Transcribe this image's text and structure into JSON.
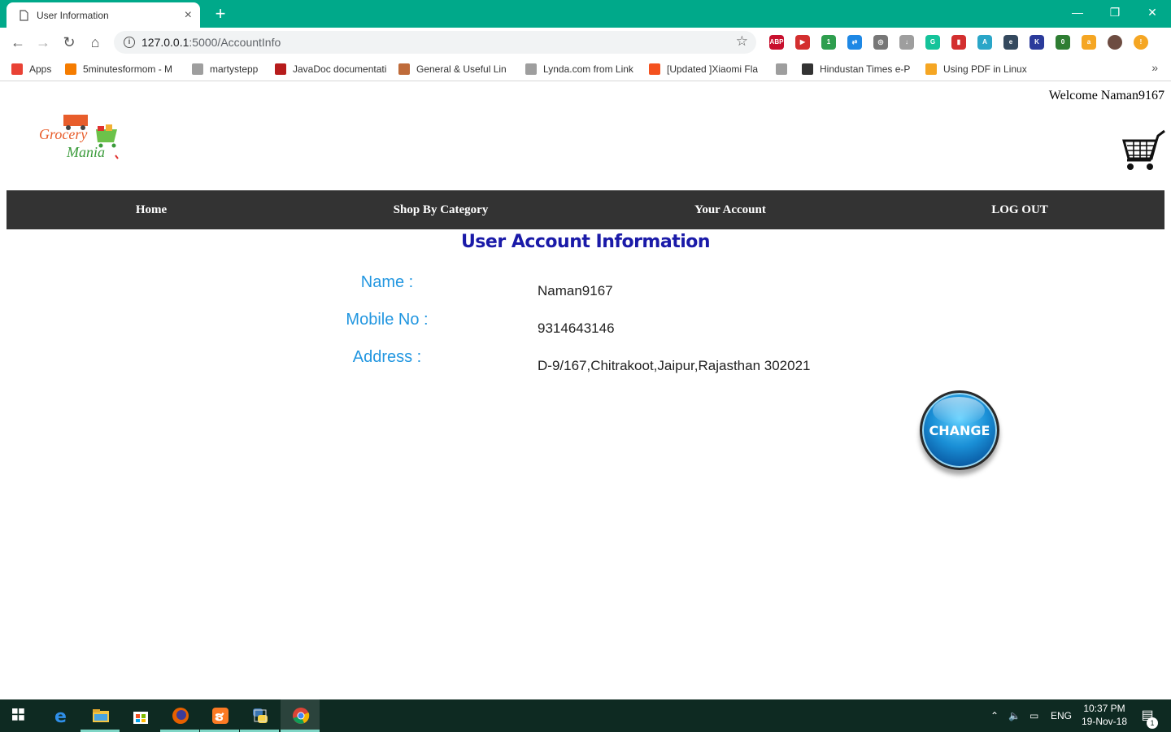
{
  "browser": {
    "tab_title": "User Information",
    "new_tab": "+",
    "url_host": "127.0.0.1",
    "url_rest": ":5000/AccountInfo",
    "window_controls": {
      "minimize": "—",
      "restore": "❐",
      "close": "✕"
    },
    "extensions": [
      {
        "name": "adblock-plus-icon",
        "text": "ABP",
        "color": "#c8102e"
      },
      {
        "name": "video-ext-icon",
        "text": "▶",
        "color": "#d32f2f"
      },
      {
        "name": "green-ext-icon",
        "text": "1",
        "color": "#2e9e4e"
      },
      {
        "name": "screen-capture-icon",
        "text": "⇄",
        "color": "#1e88e5"
      },
      {
        "name": "reel-icon",
        "text": "◎",
        "color": "#777777"
      },
      {
        "name": "download-icon",
        "text": "↓",
        "color": "#9e9e9e"
      },
      {
        "name": "grammarly-icon",
        "text": "G",
        "color": "#15c39a"
      },
      {
        "name": "red-book-icon",
        "text": "▮",
        "color": "#d32f2f"
      },
      {
        "name": "translate-icon",
        "text": "A",
        "color": "#2aa6c8"
      },
      {
        "name": "e-ext-icon",
        "text": "e",
        "color": "#34495e"
      },
      {
        "name": "k-ext-icon",
        "text": "K",
        "color": "#2b3b9b"
      },
      {
        "name": "pencil-ext-icon",
        "text": "0",
        "color": "#2e7d32"
      },
      {
        "name": "amazon-icon",
        "text": "a",
        "color": "#f5a623"
      },
      {
        "name": "profile-avatar-icon",
        "text": "",
        "color": "#6d4c41"
      },
      {
        "name": "alert-icon",
        "text": "!",
        "color": "#f5a623"
      }
    ]
  },
  "bookmarks": [
    {
      "name": "apps",
      "label": "Apps",
      "color": "#e94235"
    },
    {
      "name": "5minutes",
      "label": "5minutesformom - M",
      "color": "#f57c00"
    },
    {
      "name": "martystepp",
      "label": "martystepp",
      "color": "#9e9e9e"
    },
    {
      "name": "javadoc",
      "label": "JavaDoc documentati",
      "color": "#b71c1c"
    },
    {
      "name": "general",
      "label": "General & Useful Lin",
      "color": "#bf6b3a"
    },
    {
      "name": "lynda",
      "label": "Lynda.com from Link",
      "color": "#9e9e9e"
    },
    {
      "name": "xiaomi",
      "label": "[Updated ]Xiaomi Fla",
      "color": "#f4511e"
    },
    {
      "name": "blank",
      "label": "",
      "color": "#9e9e9e"
    },
    {
      "name": "hindustan",
      "label": "Hindustan Times e-P",
      "color": "#333333"
    },
    {
      "name": "pdf-linux",
      "label": "Using PDF in Linux",
      "color": "#f5a623"
    }
  ],
  "bookmarks_more": "»",
  "site": {
    "welcome": "Welcome Naman9167",
    "logo_text_1": "Grocery",
    "logo_text_2": "Mania",
    "nav": [
      "Home",
      "Shop By Category",
      "Your Account",
      "LOG OUT"
    ],
    "heading": "User Account Information",
    "fields": [
      {
        "label": "Name :",
        "value": "Naman9167"
      },
      {
        "label": "Mobile No :",
        "value": "9314643146"
      },
      {
        "label": "Address :",
        "value": "D-9/167,Chitrakoot,Jaipur,Rajasthan 302021"
      }
    ],
    "change_button": "CHANGE",
    "colors": {
      "nav_bg": "#333333",
      "label": "#2196e0",
      "heading": "#1a1aa8"
    }
  },
  "taskbar": {
    "language": "ENG",
    "time": "10:37 PM",
    "date": "19-Nov-18",
    "notification_count": "1"
  }
}
